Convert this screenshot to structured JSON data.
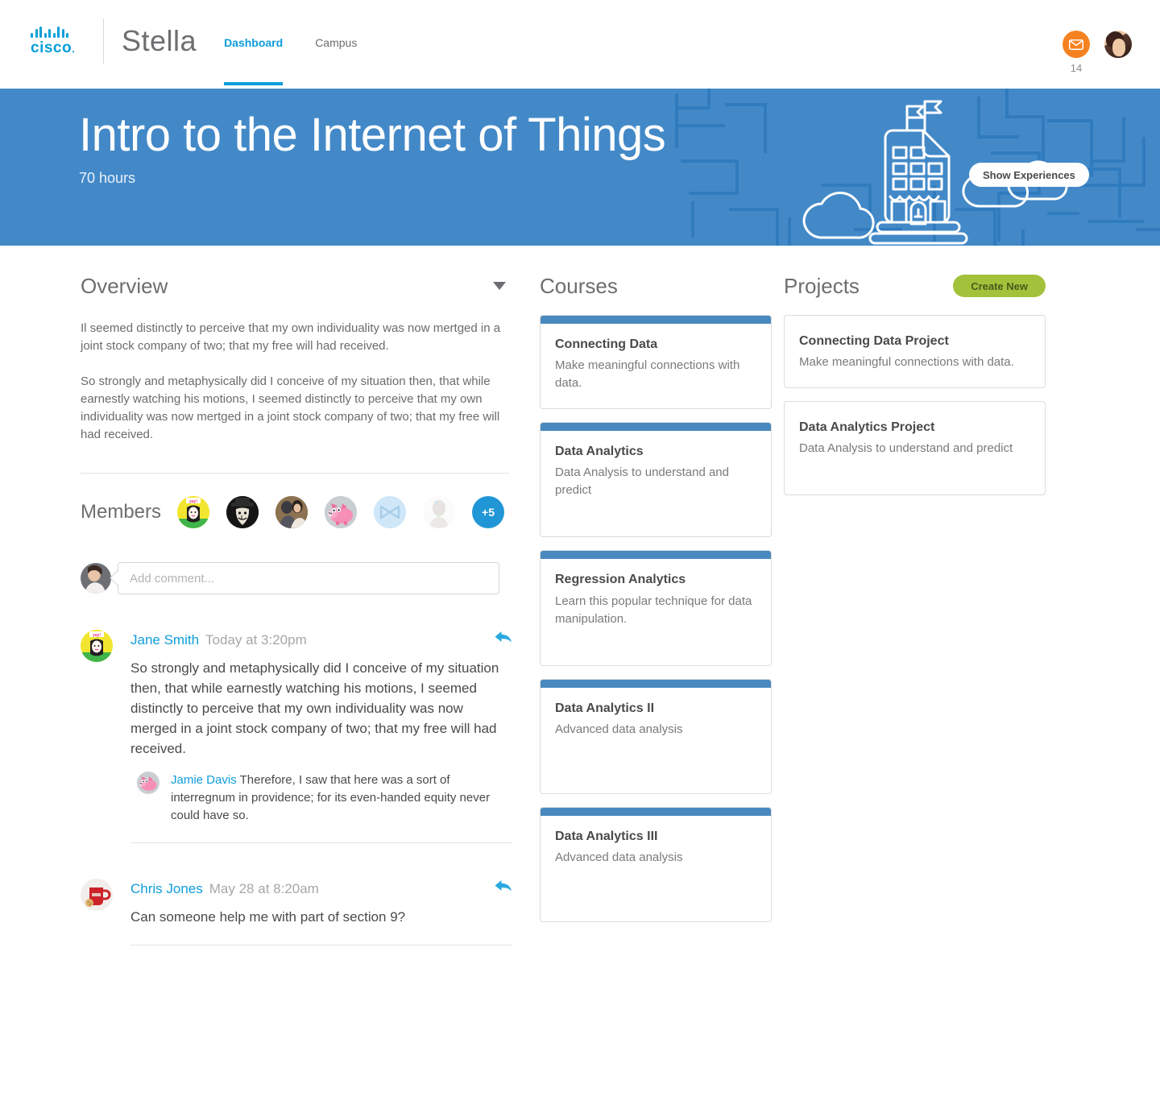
{
  "nav": {
    "logo_alt": "CISCO",
    "logo_word": "cisco",
    "brand": "Stella",
    "tabs": [
      {
        "label": "Dashboard",
        "active": true
      },
      {
        "label": "Campus",
        "active": false
      }
    ],
    "mail_icon": "envelope-icon",
    "mail_count": "14",
    "avatar_icon": "user-avatar"
  },
  "hero": {
    "title": "Intro to the Internet of Things",
    "subtitle": "70 hours",
    "button": "Show Experiences",
    "background_color": "#4389c8",
    "illustration": "school-building-clouds-circuit"
  },
  "overview": {
    "title": "Overview",
    "collapse_icon": "chevron-down-icon",
    "paragraphs": [
      "Il seemed distinctly to perceive that my own individuality was now mertged in a joint stock company of two; that my free will had received.",
      "So strongly and metaphysically did I conceive of my situation then, that while earnestly watching his motions, I seemed distinctly to perceive that my own individuality was now mertged in a joint stock company of two; that my free will had received."
    ]
  },
  "members": {
    "label": "Members",
    "avatars": [
      "avatar-jane-yay",
      "avatar-anonymous-mask",
      "avatar-couple-photo",
      "avatar-pink-pig",
      "avatar-blue-x",
      "avatar-faded-portrait"
    ],
    "more_label": "+5"
  },
  "comment_box": {
    "placeholder": "Add comment...",
    "value": "",
    "avatar": "avatar-current-user"
  },
  "comments": [
    {
      "avatar": "avatar-jane-yay",
      "author": "Jane Smith",
      "time": "Today at 3:20pm",
      "reply_icon": "reply-arrow-icon",
      "text": "So strongly and metaphysically did I conceive of my situation then, that while earnestly watching his motions, I seemed distinctly to perceive that my own individuality was now merged in a joint stock company of two; that my free will had received.",
      "replies": [
        {
          "avatar": "avatar-pink-pig",
          "author": "Jamie Davis",
          "text": "Therefore, I saw that here was a sort of interregnum in providence; for its even-handed equity never could have so."
        }
      ]
    },
    {
      "avatar": "avatar-red-mug",
      "author": "Chris Jones",
      "time": "May 28 at 8:20am",
      "reply_icon": "reply-arrow-icon",
      "text": "Can someone help me with part of section 9?",
      "replies": []
    }
  ],
  "courses": {
    "title": "Courses",
    "accent_color": "#4889bf",
    "items": [
      {
        "title": "Connecting Data",
        "desc": "Make meaningful connections with data."
      },
      {
        "title": "Data Analytics",
        "desc": "Data Analysis to understand and predict"
      },
      {
        "title": "Regression Analytics",
        "desc": "Learn this popular technique for data manipulation."
      },
      {
        "title": "Data Analytics II",
        "desc": "Advanced data analysis"
      },
      {
        "title": "Data Analytics III",
        "desc": "Advanced data analysis"
      }
    ]
  },
  "projects": {
    "title": "Projects",
    "create_button": "Create New",
    "create_color": "#a3c23b",
    "items": [
      {
        "title": "Connecting Data Project",
        "desc": "Make meaningful connections with data."
      },
      {
        "title": "Data Analytics Project",
        "desc": "Data Analysis to understand and predict"
      }
    ]
  }
}
